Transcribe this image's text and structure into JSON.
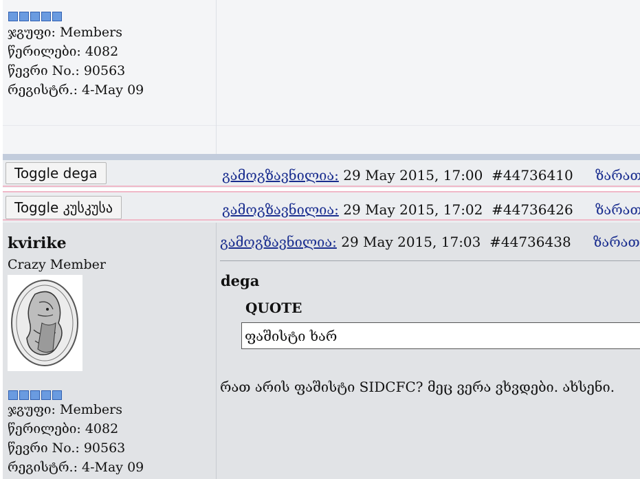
{
  "top_post": {
    "user_info": {
      "group_label": "ჯგუფი: Members",
      "posts_label": "წერილები: 4082",
      "member_no_label": "წევრი No.: 90563",
      "registered_label": "რეგისტრ.: 4-May 09"
    }
  },
  "collapsed_posts": [
    {
      "toggle_label": "Toggle dega",
      "posted_label": "გამოგზავნილია:",
      "datetime": "29 May 2015, 17:00",
      "post_id": "#44736410",
      "karma_label": "ზარათი ·"
    },
    {
      "toggle_label": "Toggle კუსკუსა",
      "posted_label": "გამოგზავნილია:",
      "datetime": "29 May 2015, 17:02",
      "post_id": "#44736426",
      "karma_label": "ზარათი ·"
    }
  ],
  "post": {
    "author": {
      "username": "kvirike",
      "rank": "Crazy Member",
      "group_label": "ჯგუფი: Members",
      "posts_label": "წერილები: 4082",
      "member_no_label": "წევრი No.: 90563",
      "registered_label": "რეგისტრ.: 4-May 09"
    },
    "header": {
      "posted_label": "გამოგზავნილია:",
      "datetime": "29 May 2015, 17:03",
      "post_id": "#44736438",
      "karma_label": "ზარათი ·"
    },
    "quote": {
      "author": "dega",
      "title": "QUOTE",
      "text": "ფაშისტი ხარ"
    },
    "body": "რათ არის ფაშისტი SIDCFC? მეც ვერა ვხვდები. ახსენი."
  },
  "colors": {
    "link": "#1a2e8f",
    "star_fill": "#6a9be0",
    "separator": "#c2ccdc",
    "toggle_row_border": "#f0b8c8",
    "post_background": "#e1e3e6"
  }
}
